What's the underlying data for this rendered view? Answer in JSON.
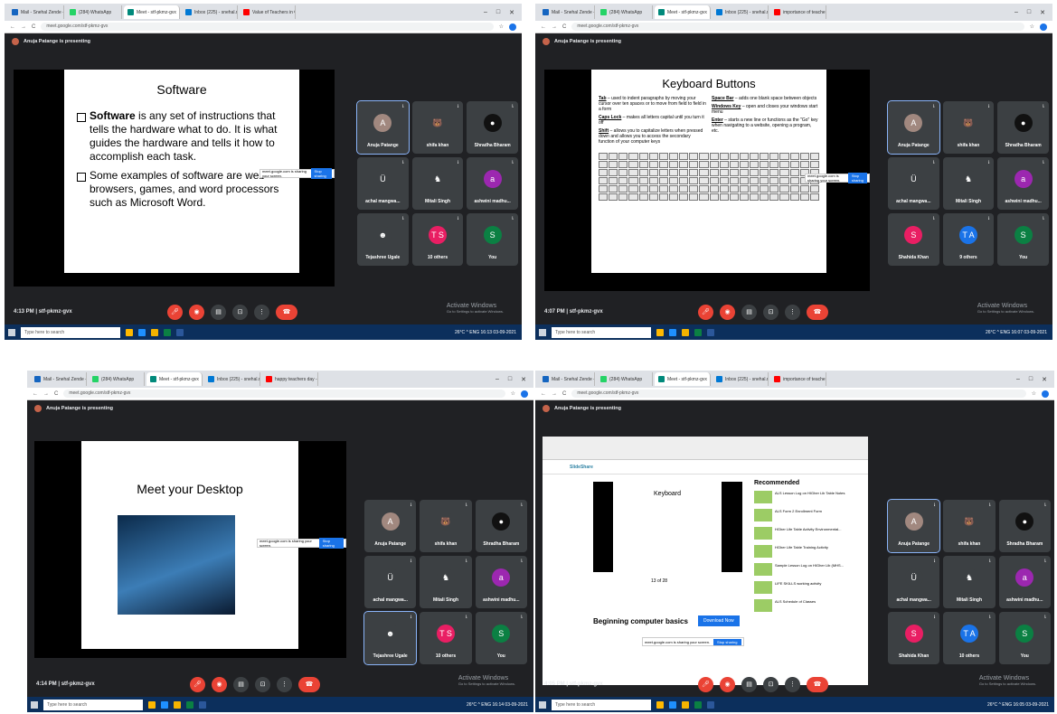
{
  "shots": [
    {
      "tabs": [
        "Mail - Snehal Zende - Outlo…",
        "(284) WhatsApp",
        "Meet - stf-pkmz-gvx",
        "Inbox (225) - snehal.mahisk…",
        "Value of Teachers in Our So…"
      ],
      "url": "meet.google.com/stf-pkmz-gvx",
      "presenting": "Anuja Patange is presenting",
      "slide_title": "Software",
      "bullets": [
        {
          "bold": "Software",
          "rest": " is any set of instructions that tells the hardware what to do. It is what guides the hardware and tells it how to accomplish each task."
        },
        {
          "bold": "",
          "rest": "Some examples of software are web browsers, games, and word processors such as Microsoft Word."
        }
      ],
      "time": "4:13 PM  |  stf-pkmz-gvx",
      "tiles": [
        {
          "name": "Anuja Patange",
          "initial": "A",
          "color": "#a1887f",
          "pin": true
        },
        {
          "name": "shifa khan",
          "initial": "🐻",
          "color": "#3c4043"
        },
        {
          "name": "Shradha Bharam",
          "initial": "●",
          "color": "#111"
        },
        {
          "name": "achal mangwa...",
          "initial": "Ü",
          "color": "#3c4043"
        },
        {
          "name": "Mitali Singh",
          "initial": "♞",
          "color": "#3c4043"
        },
        {
          "name": "ashwini madhu...",
          "initial": "a",
          "color": "#9c27b0"
        },
        {
          "name": "Tejashree Ugale",
          "initial": "☻",
          "color": "#3c4043"
        },
        {
          "name": "10 others",
          "initial": "T S",
          "color": "#e91e63"
        },
        {
          "name": "You",
          "initial": "S",
          "color": "#0b8043"
        }
      ],
      "tray": "26°C  ^  ENG  16:13 03-09-2021"
    },
    {
      "tabs": [
        "Mail - Snehal Zende - Outlo…",
        "(284) WhatsApp",
        "Meet - stf-pkmz-gvx",
        "Inbox (225) - snehal.mahisk…",
        "importance of teachers - Yo…"
      ],
      "url": "meet.google.com/stf-pkmz-gvx",
      "presenting": "Anuja Patange is presenting",
      "slide_title": "Keyboard Buttons",
      "kb_left": [
        {
          "bold": "Tab",
          "rest": " – used to indent paragraphs by moving your cursor over ten spaces or to move from field to field in a form"
        },
        {
          "bold": "Caps Lock",
          "rest": " – makes all letters capital until you turn it off"
        },
        {
          "bold": "Shift",
          "rest": " – allows you to capitalize letters when pressed down and allows you to access the secondary function of your computer keys"
        }
      ],
      "kb_right": [
        {
          "bold": "Space Bar",
          "rest": " – adds one blank space between objects"
        },
        {
          "bold": "Windows Key",
          "rest": " – open and closes your windows start menu"
        },
        {
          "bold": "Enter",
          "rest": " – starts a new line or functions as the \"Go\" key when navigating to a website, opening a program, etc."
        }
      ],
      "time": "4:07 PM  |  stf-pkmz-gvx",
      "tiles": [
        {
          "name": "Anuja Patange",
          "initial": "A",
          "color": "#a1887f",
          "pin": true
        },
        {
          "name": "shifa khan",
          "initial": "🐻",
          "color": "#3c4043"
        },
        {
          "name": "Shradha Bharam",
          "initial": "●",
          "color": "#111"
        },
        {
          "name": "achal mangwa...",
          "initial": "Ü",
          "color": "#3c4043"
        },
        {
          "name": "Mitali Singh",
          "initial": "♞",
          "color": "#3c4043"
        },
        {
          "name": "ashwini madhu...",
          "initial": "a",
          "color": "#9c27b0"
        },
        {
          "name": "Shahida Khan",
          "initial": "S",
          "color": "#e91e63"
        },
        {
          "name": "9 others",
          "initial": "T A",
          "color": "#1a73e8"
        },
        {
          "name": "You",
          "initial": "S",
          "color": "#0b8043"
        }
      ],
      "tray": "26°C  ^  ENG  16:07 03-09-2021"
    },
    {
      "tabs": [
        "Mail - Snehal Zende - Outlo…",
        "(284) WhatsApp",
        "Meet - stf-pkmz-gvx",
        "Inbox (225) - snehal.mahisk…",
        "happy teachers day - YouTu…"
      ],
      "url": "meet.google.com/stf-pkmz-gvx",
      "presenting": "Anuja Patange is presenting",
      "slide_title": "Meet your Desktop",
      "time": "4:14 PM  |  stf-pkmz-gvx",
      "tiles": [
        {
          "name": "Anuja Patange",
          "initial": "A",
          "color": "#a1887f"
        },
        {
          "name": "shifa khan",
          "initial": "🐻",
          "color": "#3c4043"
        },
        {
          "name": "Shradha Bharam",
          "initial": "●",
          "color": "#111"
        },
        {
          "name": "achal mangwa...",
          "initial": "Ü",
          "color": "#3c4043"
        },
        {
          "name": "Mitali Singh",
          "initial": "♞",
          "color": "#3c4043"
        },
        {
          "name": "ashwini madhu...",
          "initial": "a",
          "color": "#9c27b0"
        },
        {
          "name": "Tejashree Ugale",
          "initial": "☻",
          "color": "#3c4043",
          "pin": true
        },
        {
          "name": "10 others",
          "initial": "T S",
          "color": "#e91e63"
        },
        {
          "name": "You",
          "initial": "S",
          "color": "#0b8043"
        }
      ],
      "tray": "26°C  ^  ENG  16:14 03-09-2021"
    },
    {
      "tabs": [
        "Mail - Snehal Zende - Outlo…",
        "(284) WhatsApp",
        "Meet - stf-pkmz-gvx",
        "Inbox (225) - snehal.mahisk…",
        "importance of teachers - Yo…"
      ],
      "url": "meet.google.com/stf-pkmz-gvx",
      "presenting": "Anuja Patange is presenting",
      "slide_title": "Keyboard",
      "video_title": "Beginning computer basics",
      "download": "Download Now",
      "recommended": "Recommended",
      "rec_items": [
        "ALS Lesson Log on HIGher Lib Table Notes",
        "ALS Form 2 Enrollment Form",
        "HGher Life Table Activity Environmental...",
        "HGher Life Table Training Activity",
        "Sample Lesson Log on HIGher Lib (MHS...",
        "LIFE SKILLS working activity",
        "ALS Schedule of Classes"
      ],
      "page": "13 of 28",
      "time": "4:05 PM  |  stf-pkmz-gvx",
      "tiles": [
        {
          "name": "Anuja Patange",
          "initial": "A",
          "color": "#a1887f",
          "pin": true
        },
        {
          "name": "shifa khan",
          "initial": "🐻",
          "color": "#3c4043"
        },
        {
          "name": "Shradha Bharam",
          "initial": "●",
          "color": "#111"
        },
        {
          "name": "achal mangwa...",
          "initial": "Ü",
          "color": "#3c4043"
        },
        {
          "name": "Mitali Singh",
          "initial": "♞",
          "color": "#3c4043"
        },
        {
          "name": "ashwini madhu...",
          "initial": "a",
          "color": "#9c27b0"
        },
        {
          "name": "Shahida Khan",
          "initial": "S",
          "color": "#e91e63"
        },
        {
          "name": "10 others",
          "initial": "T A",
          "color": "#1a73e8"
        },
        {
          "name": "You",
          "initial": "S",
          "color": "#0b8043"
        }
      ],
      "tray": "26°C  ^  ENG  16:05 03-09-2021"
    }
  ],
  "common": {
    "search_placeholder": "Type here to search",
    "share_text": "meet.google.com is sharing your screen.",
    "stop_sharing": "Stop sharing",
    "activate": "Activate Windows",
    "activate_sub": "Go to Settings to activate Windows."
  }
}
